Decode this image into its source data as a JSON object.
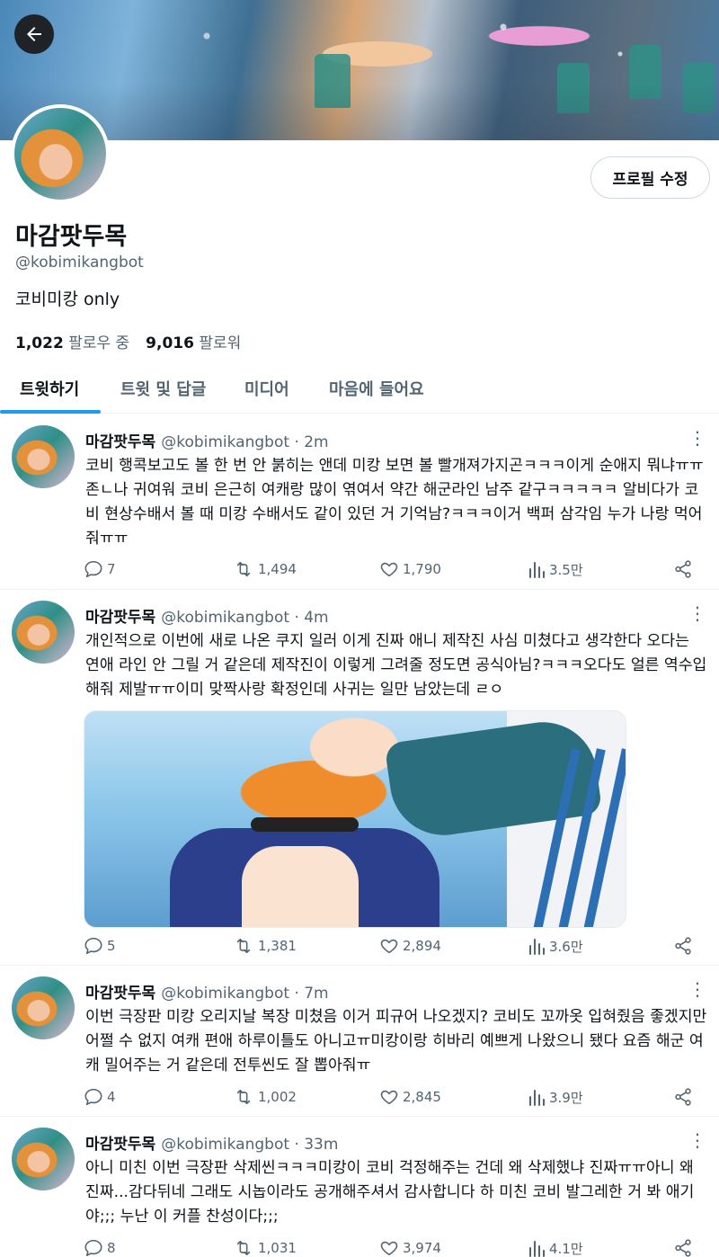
{
  "header": {
    "back_icon": "arrow-left-icon",
    "edit_profile_label": "프로필 수정"
  },
  "profile": {
    "display_name": "마감팟두목",
    "handle": "@kobimikangbot",
    "bio": "코비미캉 only",
    "following_count": "1,022",
    "following_label": "팔로우 중",
    "followers_count": "9,016",
    "followers_label": "팔로워"
  },
  "tabs": [
    {
      "label": "트윗하기",
      "active": true
    },
    {
      "label": "트윗 및 답글",
      "active": false
    },
    {
      "label": "미디어",
      "active": false
    },
    {
      "label": "마음에 들어요",
      "active": false
    }
  ],
  "colors": {
    "accent": "#1d9bf0",
    "text": "#0f1419",
    "muted": "#536471"
  },
  "tweets": [
    {
      "name": "마감팟두목",
      "handle": "@kobimikangbot",
      "time": "· 2m",
      "text": "코비 행콕보고도 볼 한 번 안 붉히는 앤데 미캉 보면 볼 빨개져가지곤ㅋㅋㅋ이게 순애지 뭐냐ㅠㅠ존ㄴ나 귀여워 코비 은근히 여캐랑 많이 엮여서 약간 해군라인 남주 같구ㅋㅋㅋㅋㅋ 알비다가 코비 현상수배서 볼 때 미캉 수배서도 같이 있던 거 기억남?ㅋㅋㅋ이거 백퍼 삼각임 누가 나랑 먹어줘ㅠㅠ",
      "replies": "7",
      "retweets": "1,494",
      "likes": "1,790",
      "views": "3.5만"
    },
    {
      "name": "마감팟두목",
      "handle": "@kobimikangbot",
      "time": "· 4m",
      "text": "개인적으로 이번에 새로 나온 쿠지 일러 이게 진짜 애니 제작진 사심 미쳤다고 생각한다 오다는 연애 라인 안 그릴 거 같은데 제작진이 이렇게 그려줄 정도면 공식아님?ㅋㅋㅋ오다도 얼른 역수입해줘 제발ㅠㅠ이미 맞짝사랑 확정인데 사귀는 일만 남았는데 ㄹㅇ",
      "replies": "5",
      "retweets": "1,381",
      "likes": "2,894",
      "views": "3.6만"
    },
    {
      "name": "마감팟두목",
      "handle": "@kobimikangbot",
      "time": "· 7m",
      "text": "이번 극장판 미캉 오리지날 복장 미쳤음 이거 피규어 나오겠지? 코비도 꼬까옷 입혀줬음 좋겠지만 어쩔 수 없지 여캐 편애 하루이틀도 아니고ㅠ미캉이랑 히바리 예쁘게 나왔으니 됐다 요즘 해군 여캐 밀어주는 거 같은데 전투씬도 잘 뽑아줘ㅠ",
      "replies": "4",
      "retweets": "1,002",
      "likes": "2,845",
      "views": "3.9만"
    },
    {
      "name": "마감팟두목",
      "handle": "@kobimikangbot",
      "time": "· 33m",
      "text": "아니 미친 이번 극장판 삭제씬ㅋㅋㅋ미캉이 코비 걱정해주는 건데 왜 삭제했냐 진짜ㅠㅠ아니 왜 진짜...감다뒤네 그래도 시놉이라도 공개해주셔서 감사합니다 하 미친 코비 발그레한 거 봐 애기야;;; 누난 이 커플 찬성이다;;;",
      "replies": "8",
      "retweets": "1,031",
      "likes": "3,974",
      "views": "4.1만"
    }
  ]
}
